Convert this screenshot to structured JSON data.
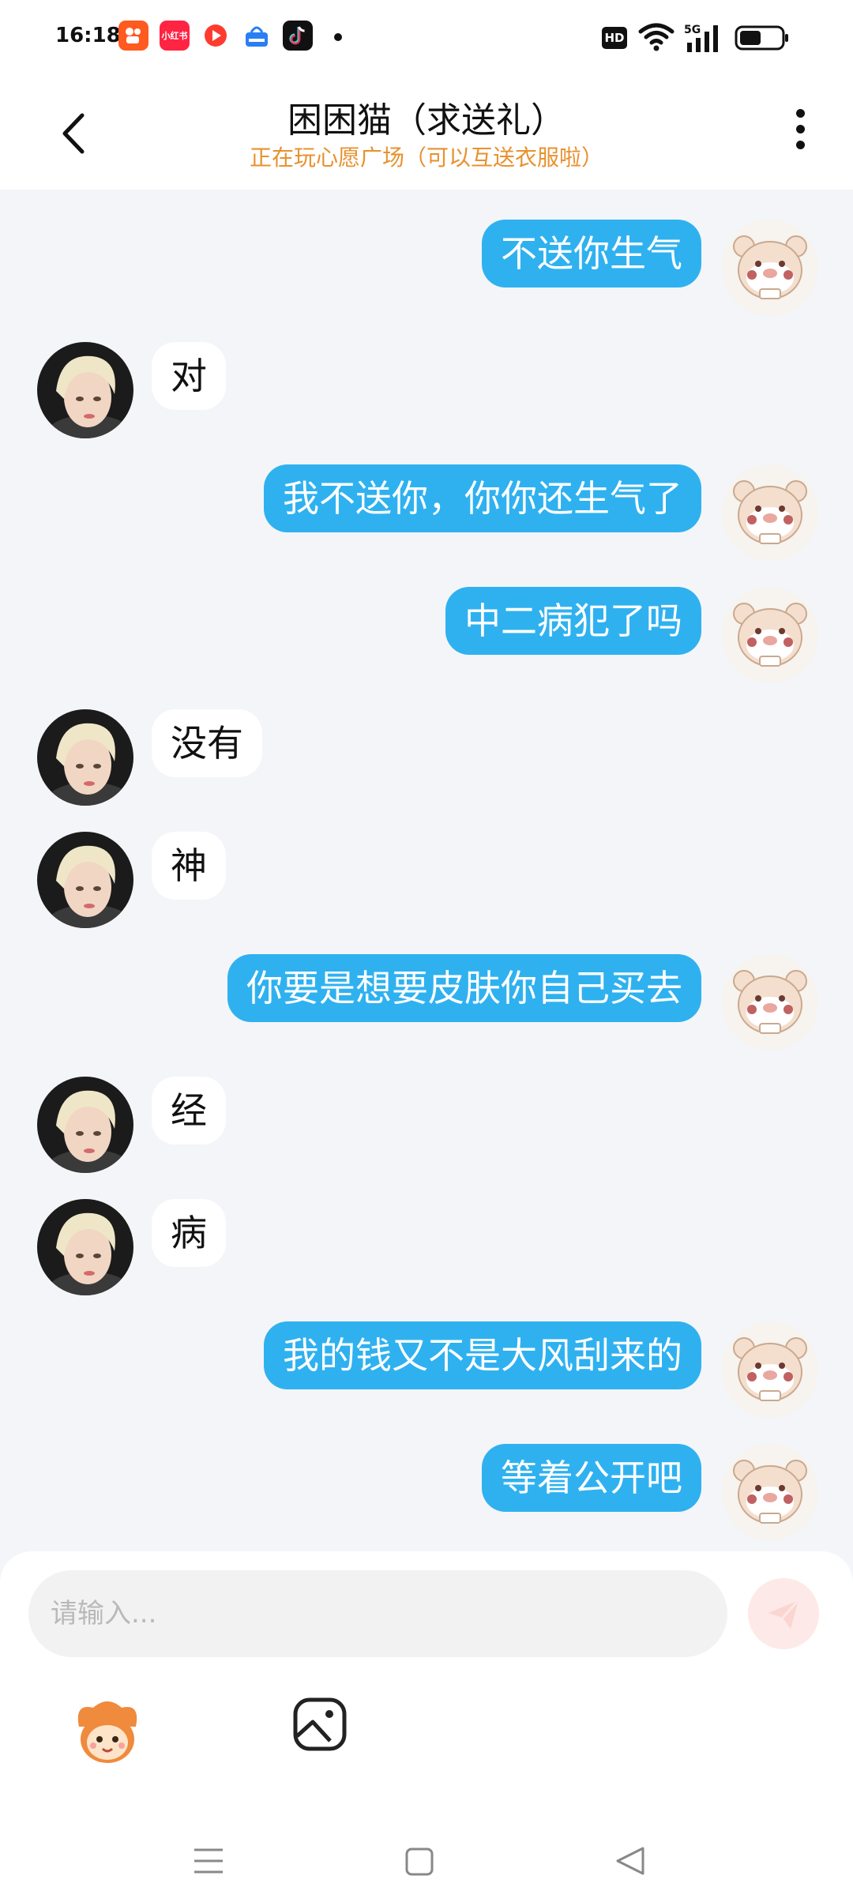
{
  "status_bar": {
    "time": "16:18",
    "apps": [
      {
        "name": "kuaishou-icon",
        "label": "",
        "color": "#ff5a1f"
      },
      {
        "name": "xiaohongshu-icon",
        "label": "小红书",
        "color": "#ff2442"
      },
      {
        "name": "video-app-icon",
        "label": "",
        "color": "#ff3b30"
      },
      {
        "name": "app-store-icon",
        "label": "",
        "color": "#2a7ef4"
      },
      {
        "name": "tiktok-icon",
        "label": "",
        "color": "#111111"
      }
    ],
    "hd_label": "HD",
    "network_label": "5G"
  },
  "header": {
    "title": "困困猫（求送礼）",
    "subtitle": "正在玩心愿广场（可以互送衣服啦）"
  },
  "messages": [
    {
      "side": "right",
      "text": "不送你生气"
    },
    {
      "side": "left",
      "text": "对"
    },
    {
      "side": "right",
      "text": "我不送你，你你还生气了"
    },
    {
      "side": "right",
      "text": "中二病犯了吗"
    },
    {
      "side": "left",
      "text": "没有"
    },
    {
      "side": "left",
      "text": "神"
    },
    {
      "side": "right",
      "text": "你要是想要皮肤你自己买去"
    },
    {
      "side": "left",
      "text": "经"
    },
    {
      "side": "left",
      "text": "病"
    },
    {
      "side": "right",
      "text": "我的钱又不是大风刮来的"
    },
    {
      "side": "right",
      "text": "等着公开吧"
    }
  ],
  "input": {
    "placeholder": "请输入...",
    "value": ""
  },
  "colors": {
    "accent": "#2fb1f0",
    "subtitle": "#e8912e",
    "send_button": "#fde9e7"
  }
}
